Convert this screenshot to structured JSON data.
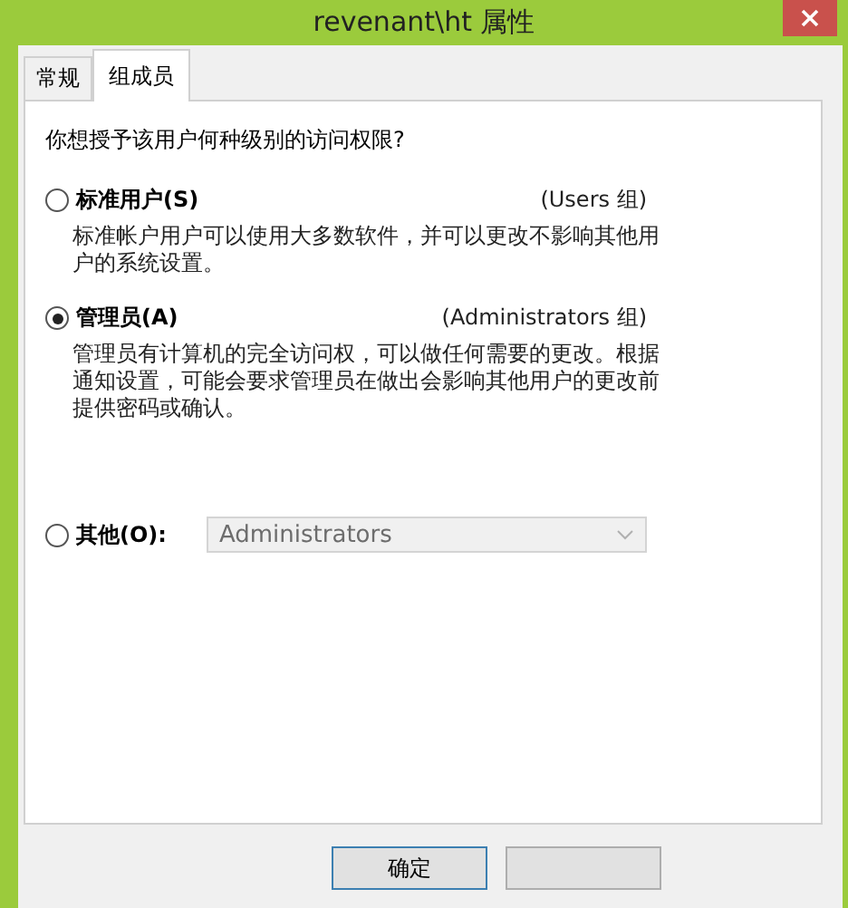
{
  "window": {
    "title": "revenant\\ht 属性"
  },
  "tabs": [
    {
      "label": "常规",
      "selected": false
    },
    {
      "label": "组成员",
      "selected": true
    }
  ],
  "question": "你想授予该用户何种级别的访问权限?",
  "options": [
    {
      "kind": "described",
      "label": "标准用户(S)",
      "group": "(Users 组)",
      "description": "标准帐户用户可以使用大多数软件，并可以更改不影响其他用户的系统设置。",
      "selected": false
    },
    {
      "kind": "described",
      "label": "管理员(A)",
      "group": "(Administrators 组)",
      "description": "管理员有计算机的完全访问权，可以做任何需要的更改。根据通知设置，可能会要求管理员在做出会影响其他用户的更改前提供密码或确认。",
      "selected": true
    },
    {
      "kind": "dropdown",
      "label": "其他(O):",
      "selected": false,
      "dropdown": {
        "value": "Administrators",
        "disabled": true
      }
    }
  ],
  "buttons": [
    {
      "kind": "labeled",
      "label": "确定"
    },
    {
      "kind": "covered"
    }
  ]
}
